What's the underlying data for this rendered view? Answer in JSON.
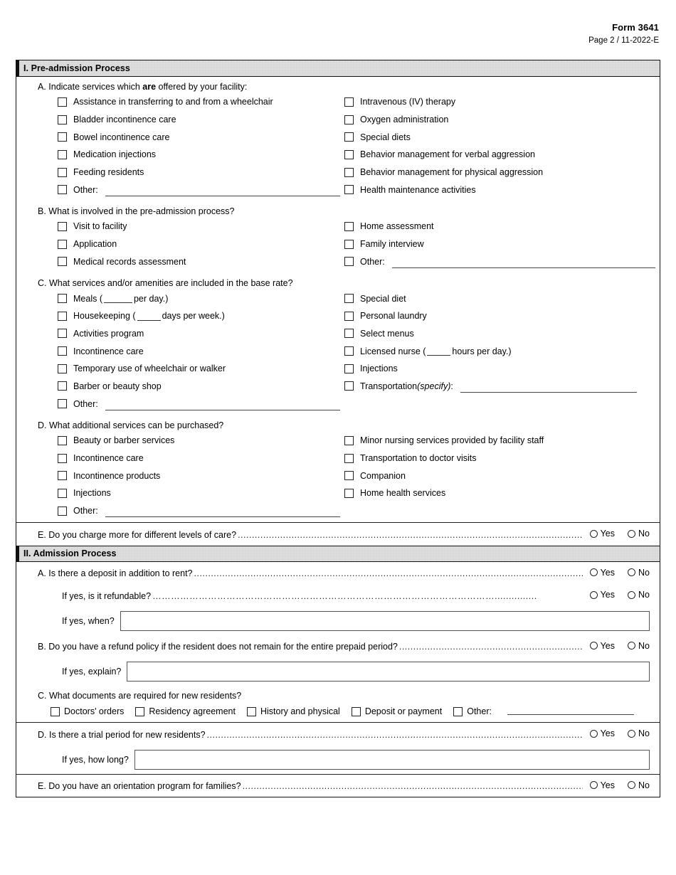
{
  "header": {
    "form_number": "Form 3641",
    "page_line": "Page 2  / 11-2022-E"
  },
  "sections": [
    {
      "id": "pre-admission",
      "title": "I. Pre-admission Process",
      "questions": {
        "a": {
          "label_pre": "A. Indicate services which ",
          "label_bold": "are",
          "label_post": " offered by your facility:",
          "left": [
            "Assistance in transferring to and from a wheelchair",
            "Bladder incontinence care",
            "Bowel incontinence care",
            "Medication injections",
            "Feeding residents",
            "Other:"
          ],
          "right": [
            "Intravenous (IV) therapy",
            "Oxygen administration",
            "Special diets",
            "Behavior management for verbal aggression",
            "Behavior management for physical aggression",
            "Health maintenance activities"
          ]
        },
        "b": {
          "label": "B. What is involved in the pre-admission process?",
          "left": [
            "Visit to facility",
            "Application",
            "Medical records assessment"
          ],
          "right": [
            "Home assessment",
            "Family interview",
            "Other:"
          ]
        },
        "c": {
          "label": "C. What services and/or amenities are included in the base rate?",
          "left": [
            "Meals (",
            "Housekeeping  (",
            "Activities program",
            "Incontinence care",
            "Temporary use of wheelchair or walker",
            "Barber or beauty shop",
            "Other:"
          ],
          "meals_suffix": "per day.)",
          "housekeeping_suffix": "days per week.)",
          "right": [
            "Special diet",
            "Personal laundry",
            "Select menus",
            "Licensed nurse (",
            "Injections",
            "Transportation "
          ],
          "nurse_suffix": "hours per day.)",
          "transportation_specify": "(specify)",
          "transportation_colon": ":"
        },
        "d": {
          "label": "D. What additional services can be purchased?",
          "left": [
            "Beauty or barber services",
            "Incontinence care",
            "Incontinence products",
            "Injections",
            "Other:"
          ],
          "right": [
            "Minor nursing services provided by facility staff",
            "Transportation to doctor visits",
            "Companion",
            "Home health services"
          ]
        },
        "e": {
          "label": "E. Do you charge more for different levels of care?",
          "yes": "Yes",
          "no": "No"
        }
      }
    },
    {
      "id": "admission",
      "title": "II. Admission Process",
      "questions": {
        "a": {
          "label": "A. Is there a deposit in addition to rent?",
          "sub_label": "If yes, is it refundable?",
          "when_label": "If yes, when?",
          "when_value": "",
          "yes": "Yes",
          "no": "No"
        },
        "b": {
          "label": "B. Do you have a refund policy if the resident does not remain for the entire prepaid period?",
          "explain_label": "If yes, explain?",
          "explain_value": "",
          "yes": "Yes",
          "no": "No"
        },
        "c": {
          "label": "C. What documents are required for new residents?",
          "items": [
            "Doctors' orders",
            "Residency agreement",
            "History and physical",
            "Deposit or payment",
            "Other:"
          ]
        },
        "d": {
          "label": "D. Is there a trial period for new residents?",
          "howlong_label": "If yes, how long?",
          "howlong_value": "",
          "yes": "Yes",
          "no": "No"
        },
        "e": {
          "label": "E. Do you have an orientation program for families?",
          "yes": "Yes",
          "no": "No"
        }
      }
    }
  ],
  "colors": {
    "section_header_bg": "#dcdcdc",
    "border": "#111111",
    "text": "#000000"
  }
}
